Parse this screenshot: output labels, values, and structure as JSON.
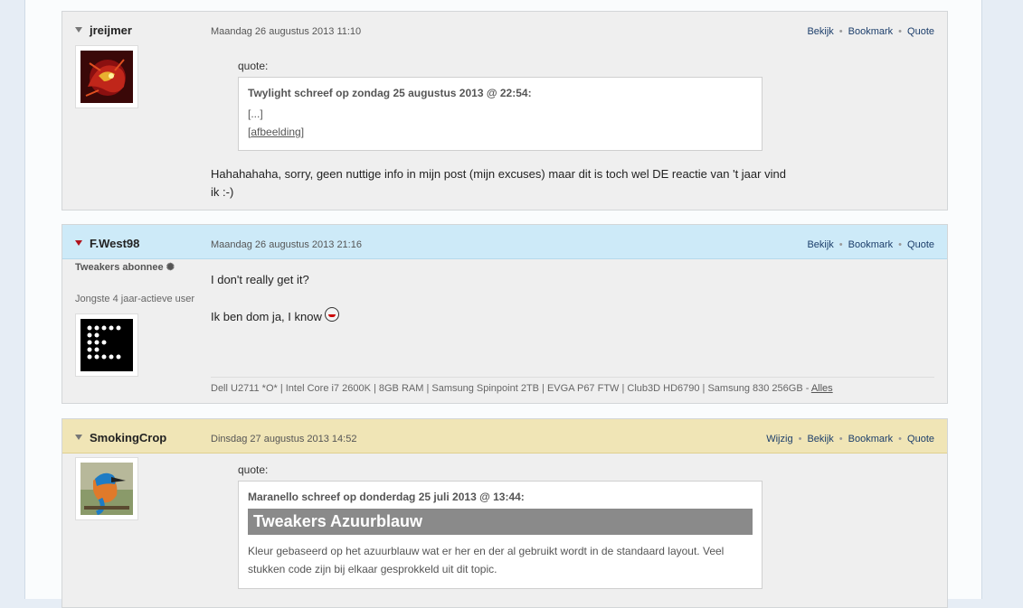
{
  "posts": [
    {
      "author": "jreijmer",
      "date": "Maandag 26 augustus 2013 11:10",
      "actions": [
        "Bekijk",
        "Bookmark",
        "Quote"
      ],
      "quote": {
        "label": "quote:",
        "header": "Twylight schreef op zondag 25 augustus 2013 @ 22:54:",
        "lines": [
          "[...]"
        ],
        "link": "afbeelding",
        "link_prefix": "[",
        "link_suffix": "]"
      },
      "body": [
        "Hahahahaha, sorry, geen nuttige info in mijn post (mijn excuses) maar dit is toch wel DE reactie van 't jaar vind",
        "ik :-)"
      ]
    },
    {
      "author": "F.West98",
      "date": "Maandag 26 augustus 2013 21:16",
      "actions": [
        "Bekijk",
        "Bookmark",
        "Quote"
      ],
      "badge": "Tweakers abonnee",
      "badge_icon": "gear-icon",
      "user_note": "Jongste 4 jaar-actieve user",
      "body": [
        "I don't really get it?",
        "Ik ben dom ja, I know"
      ],
      "signature": "Dell U2711 *O* | Intel Core i7 2600K | 8GB RAM | Samsung Spinpoint 2TB | EVGA P67 FTW | Club3D HD6790 | Samsung 830 256GB -",
      "signature_more": "Alles"
    },
    {
      "author": "SmokingCrop",
      "date": "Dinsdag 27 augustus 2013 14:52",
      "actions": [
        "Wijzig",
        "Bekijk",
        "Bookmark",
        "Quote"
      ],
      "quote": {
        "label": "quote:",
        "header": "Maranello schreef op donderdag 25 juli 2013 @ 13:44:",
        "title": "Tweakers Azuurblauw",
        "text": "Kleur gebaseerd op het azuurblauw wat er her en der al gebruikt wordt in de standaard layout. Veel stukken code zijn bij elkaar gesprokkeld uit dit topic."
      }
    }
  ]
}
